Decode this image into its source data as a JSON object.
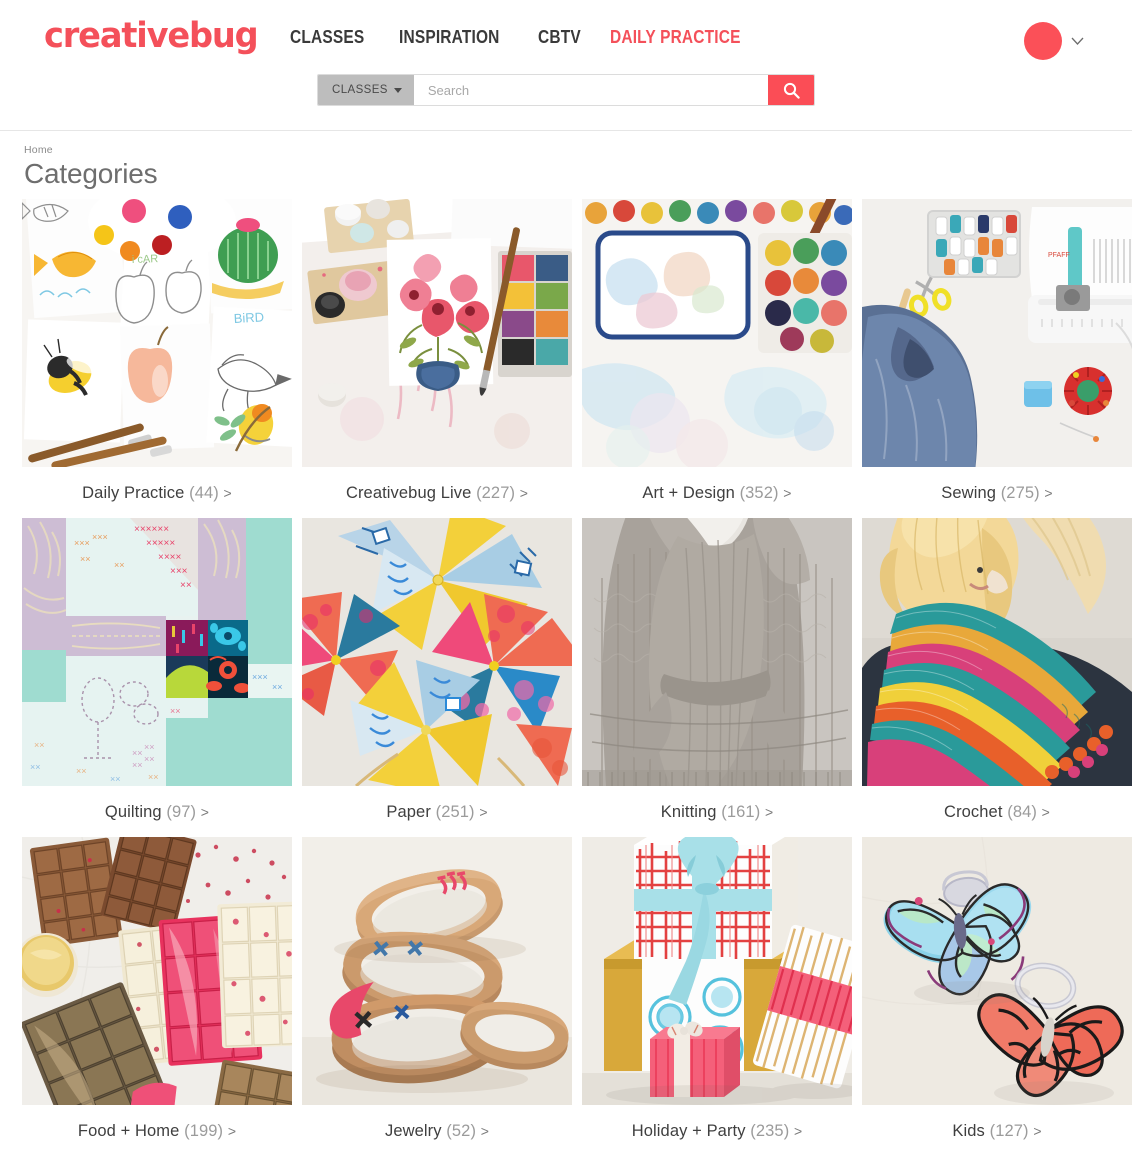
{
  "header": {
    "logo_text": "creativebug",
    "nav": [
      {
        "label": "CLASSES",
        "accent": false
      },
      {
        "label": "INSPIRATION",
        "accent": false
      },
      {
        "label": "CBTV",
        "accent": false
      },
      {
        "label": "DAILY PRACTICE",
        "accent": true
      }
    ],
    "account": {
      "avatar_color": "#fb5058",
      "caret_icon": "chevron-down-icon"
    }
  },
  "search": {
    "scope_label": "CLASSES",
    "placeholder": "Search",
    "value": "",
    "button_icon": "search-icon",
    "button_color": "#fb4d56"
  },
  "page": {
    "breadcrumb": "Home",
    "title": "Categories"
  },
  "categories": [
    {
      "name": "Daily Practice",
      "count": "(44)",
      "chevron": ">",
      "image": "watercolor-illustrations"
    },
    {
      "name": "Creativebug Live",
      "count": "(227)",
      "chevron": ">",
      "image": "floral-painting-palette"
    },
    {
      "name": "Art + Design",
      "count": "(352)",
      "chevron": ">",
      "image": "watercolor-tray-brush"
    },
    {
      "name": "Sewing",
      "count": "(275)",
      "chevron": ">",
      "image": "sewing-machine-denim"
    },
    {
      "name": "Quilting",
      "count": "(97)",
      "chevron": ">",
      "image": "patchwork-quilt-block"
    },
    {
      "name": "Paper",
      "count": "(251)",
      "chevron": ">",
      "image": "paper-pinwheels"
    },
    {
      "name": "Knitting",
      "count": "(161)",
      "chevron": ">",
      "image": "grey-knit-cardigan"
    },
    {
      "name": "Crochet",
      "count": "(84)",
      "chevron": ">",
      "image": "crochet-striped-shawl"
    },
    {
      "name": "Food + Home",
      "count": "(199)",
      "chevron": ">",
      "image": "chocolate-bars"
    },
    {
      "name": "Jewelry",
      "count": "(52)",
      "chevron": ">",
      "image": "leather-bracelets"
    },
    {
      "name": "Holiday + Party",
      "count": "(235)",
      "chevron": ">",
      "image": "wrapped-gift-boxes"
    },
    {
      "name": "Kids",
      "count": "(127)",
      "chevron": ">",
      "image": "butterfly-rings"
    }
  ],
  "theme": {
    "brand_red": "#f4505a",
    "search_button_red": "#fb4d56",
    "text_dark": "#3f3f3f",
    "text_muted": "#9b9b9b",
    "title_grey": "#6e6e6e"
  }
}
